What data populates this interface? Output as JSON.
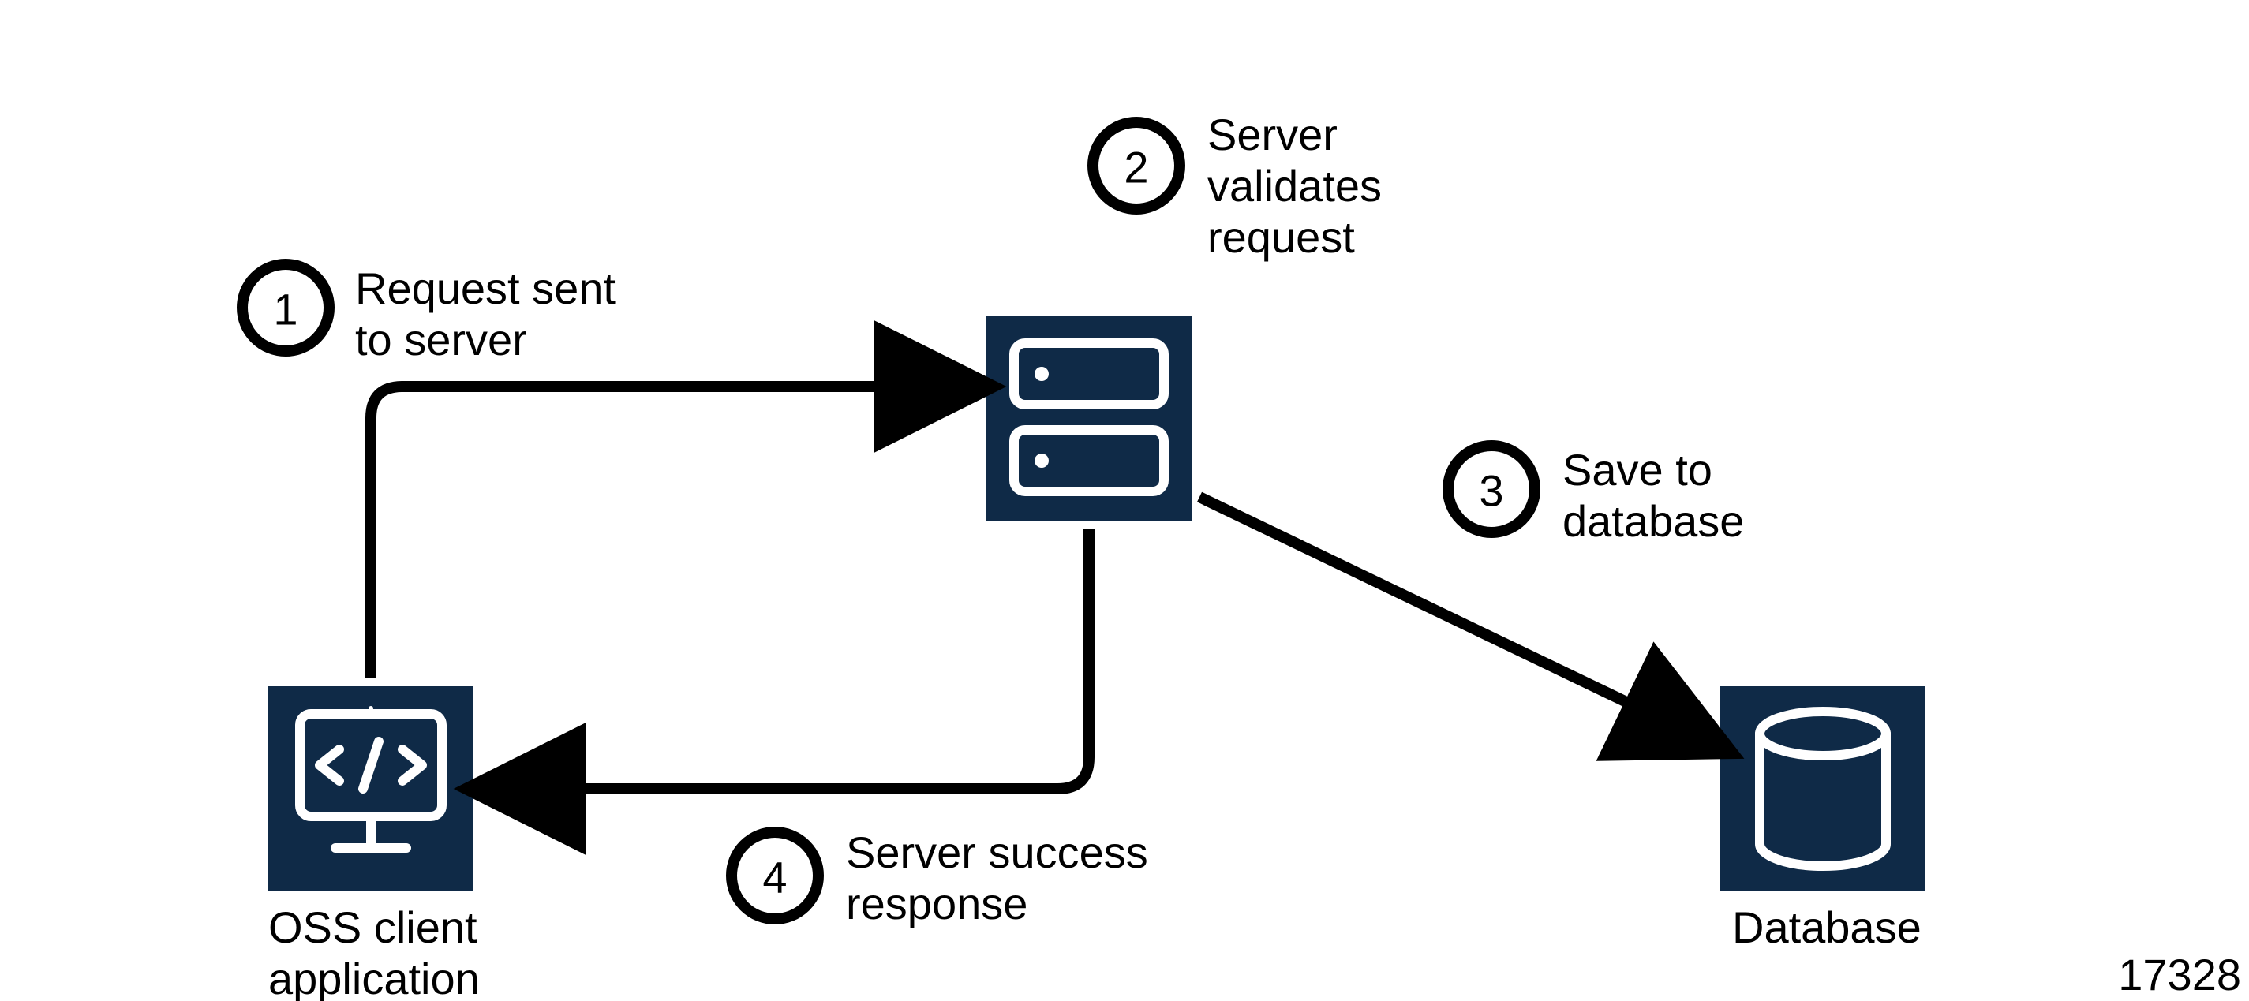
{
  "nodes": {
    "client": {
      "label_l1": "OSS client",
      "label_l2": "application"
    },
    "server": {
      "label_l1": "",
      "label_l2": ""
    },
    "database": {
      "label_l1": "Database",
      "label_l2": ""
    }
  },
  "steps": {
    "s1": {
      "num": "1",
      "l1": "Request sent",
      "l2": "to server"
    },
    "s2": {
      "num": "2",
      "l1": "Server",
      "l2": "validates",
      "l3": "request"
    },
    "s3": {
      "num": "3",
      "l1": "Save to",
      "l2": "database"
    },
    "s4": {
      "num": "4",
      "l1": "Server success",
      "l2": "response"
    }
  },
  "footer_id": "17328",
  "colors": {
    "navy": "#0f2a47",
    "black": "#000000"
  }
}
